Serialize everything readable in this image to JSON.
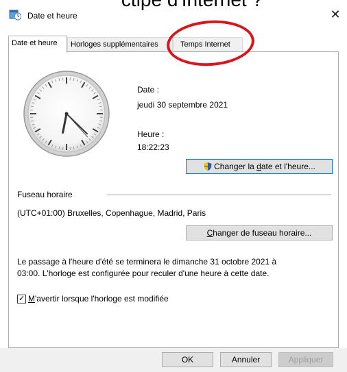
{
  "overlay_caption": "ctipe d'Internet ?",
  "window": {
    "title": "Date et heure",
    "close_glyph": "✕",
    "icon": "date-time-icon"
  },
  "tabs": [
    {
      "label": "Date et heure",
      "active": true
    },
    {
      "label": "Horloges supplémentaires",
      "active": false
    },
    {
      "label": "Temps Internet",
      "active": false
    }
  ],
  "clock": {
    "hour": 18,
    "minute": 22,
    "second": 23
  },
  "date": {
    "label": "Date :",
    "value": "jeudi 30 septembre 2021"
  },
  "time": {
    "label": "Heure :",
    "value": "18:22:23"
  },
  "change_datetime_button": {
    "label_pre": "Changer la ",
    "label_underlined": "d",
    "label_post": "ate et l'heure...",
    "icon": "uac-shield-icon"
  },
  "timezone": {
    "section_label": "Fuseau horaire",
    "value": "(UTC+01:00) Bruxelles, Copenhague, Madrid, Paris",
    "button_underlined": "C",
    "button_rest": "hanger de fuseau horaire..."
  },
  "dst_notice": {
    "line1": "Le passage à l'heure d'été se terminera le dimanche 31 octobre 2021 à",
    "line2": "03:00. L'horloge est configurée pour reculer d'une heure à cette date."
  },
  "notify_checkbox": {
    "checked": true,
    "label_underlined": "M",
    "label_rest": "'avertir lorsque l'horloge est modifiée"
  },
  "footer": {
    "ok_label": "OK",
    "cancel_label": "Annuler",
    "apply_label": "Appliquer"
  },
  "colors": {
    "annotation_ring": "#d9151b",
    "focus_border": "#0078d7"
  }
}
